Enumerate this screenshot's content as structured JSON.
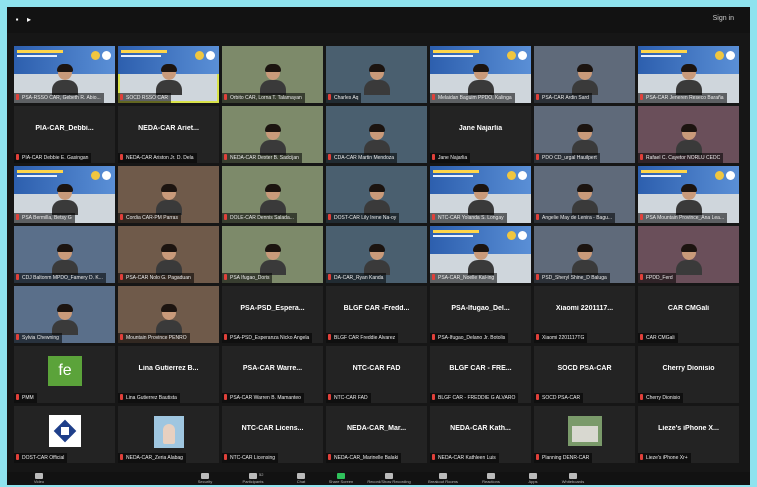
{
  "topbar": {
    "signin_label": "Sign in"
  },
  "participants": [
    {
      "label": "PSA-RSSO CAR, Gebeth R. Abio...",
      "kind": "banner"
    },
    {
      "label": "SOCD RSSO CAR",
      "kind": "banner"
    },
    {
      "label": "Orbito CAR, Lorna T. Talamayan",
      "kind": "video"
    },
    {
      "label": "Charles Aq",
      "kind": "video"
    },
    {
      "label": "Melaidan Baguim PPDO, Kalinga",
      "kind": "banner"
    },
    {
      "label": "PSA-CAR Ardin Sard",
      "kind": "video"
    },
    {
      "label": "PSA-CAR Jeneren Reseco Baraña",
      "kind": "banner"
    },
    {
      "label": "PIA-CAR Debbie E. Gasingan",
      "kind": "name",
      "display_name": "PIA-CAR_Debbi..."
    },
    {
      "label": "NEDA-CAR Ariston Jr. D. Dela",
      "kind": "name",
      "display_name": "NEDA-CAR Ariet..."
    },
    {
      "label": "NEDA-CAR Dexter B. Sadcijan",
      "kind": "video"
    },
    {
      "label": "CDA-CAR Martin Mendoza",
      "kind": "video"
    },
    {
      "label": "Jane Najarlia",
      "kind": "name",
      "display_name": "Jane Najarlia"
    },
    {
      "label": "PDO CD_urgal Hauilpert",
      "kind": "video"
    },
    {
      "label": "Rafael C. Cayetor NORLU CEDC",
      "kind": "video"
    },
    {
      "label": "PSA Bermilla, Betsy G",
      "kind": "banner"
    },
    {
      "label": "Cordia CAR-PM Parras",
      "kind": "video"
    },
    {
      "label": "DOLE-CAR Dennis Salada...",
      "kind": "video"
    },
    {
      "label": "DOST-CAR Lily Irene Na-oy",
      "kind": "video"
    },
    {
      "label": "NTC-CAR Yolanda S. Longay",
      "kind": "banner"
    },
    {
      "label": "Angelie May de Lenira - Bagu...",
      "kind": "video"
    },
    {
      "label": "PSA Mountain Province_Ana Lea...",
      "kind": "banner"
    },
    {
      "label": "CDJ Baltonm MPDO_Famery D. K...",
      "kind": "video"
    },
    {
      "label": "PSA-CAR Nolo G. Pagaduan",
      "kind": "video"
    },
    {
      "label": "PSA Ifugao_Doris",
      "kind": "video"
    },
    {
      "label": "DA-CAR_Ryan Kanda",
      "kind": "video"
    },
    {
      "label": "PSA-CAR_Noelle Kal-ing",
      "kind": "banner"
    },
    {
      "label": "PSD_Sheryl Shine_D Baluga",
      "kind": "video"
    },
    {
      "label": "FPDD_Ferd",
      "kind": "video"
    },
    {
      "label": "Sylvia Chewning",
      "kind": "video"
    },
    {
      "label": "Mountain Province PENRO",
      "kind": "video"
    },
    {
      "label": "PSA-PSD_Esperanza Nicko Angela",
      "kind": "name",
      "display_name": "PSA-PSD_Espera..."
    },
    {
      "label": "BLGF CAR Freddie Alvarez",
      "kind": "name",
      "display_name": "BLGF CAR -Fredd..."
    },
    {
      "label": "PSA-Ifugao_Delano Jr. Botolis",
      "kind": "name",
      "display_name": "PSA-Ifugao_Del..."
    },
    {
      "label": "Xiaomi 2201117TG",
      "kind": "name",
      "display_name": "Xiaomi 2201117..."
    },
    {
      "label": "CAR CMGali",
      "kind": "name",
      "display_name": "CAR CMGali"
    },
    {
      "label": "PMM",
      "kind": "fe",
      "avatar_text": "fe"
    },
    {
      "label": "Lina Gutierrez Bautista",
      "kind": "name",
      "display_name": "Lina Gutierrez B..."
    },
    {
      "label": "PSA-CAR Warren B. Mamanteo",
      "kind": "name",
      "display_name": "PSA-CAR Warre..."
    },
    {
      "label": "NTC-CAR FAD",
      "kind": "name",
      "display_name": "NTC-CAR FAD"
    },
    {
      "label": "BLGF CAR - FREDDIE G ALVARO",
      "kind": "name",
      "display_name": "BLGF CAR - FRE..."
    },
    {
      "label": "SOCD PSA-CAR",
      "kind": "name",
      "display_name": "SOCD PSA-CAR"
    },
    {
      "label": "Cherry Dionisio",
      "kind": "name",
      "display_name": "Cherry Dionisio"
    },
    {
      "label": "DOST-CAR Official",
      "kind": "logo"
    },
    {
      "label": "NEDA-CAR_Zeria Alabag",
      "kind": "photo"
    },
    {
      "label": "NTC-CAR Licensing",
      "kind": "name",
      "display_name": "NTC-CAR Licens..."
    },
    {
      "label": "NEDA-CAR_Marinelle Balaki",
      "kind": "name",
      "display_name": "NEDA-CAR_Mar..."
    },
    {
      "label": "NEDA-CAR Kathleen Luis",
      "kind": "name",
      "display_name": "NEDA-CAR Kath..."
    },
    {
      "label": "Planning DENR-CAR",
      "kind": "building"
    },
    {
      "label": "Lieze's iPhone Xr+",
      "kind": "name",
      "display_name": "Lieze's iPhone X..."
    }
  ],
  "toolbar": [
    {
      "label": "Video"
    },
    {
      "label": "Security"
    },
    {
      "label": "Participants",
      "count": "52"
    },
    {
      "label": "Chat"
    },
    {
      "label": "Share Screen"
    },
    {
      "label": "Record/Show Recording"
    },
    {
      "label": "Breakout Rooms"
    },
    {
      "label": "Reactions"
    },
    {
      "label": "Apps"
    },
    {
      "label": "Whiteboards"
    }
  ],
  "colors": {
    "accent_green": "#2fc25b",
    "speaking_outline": "#d9e34a",
    "muted_mic": "#e0403a",
    "frame": "#8fe3ee"
  }
}
